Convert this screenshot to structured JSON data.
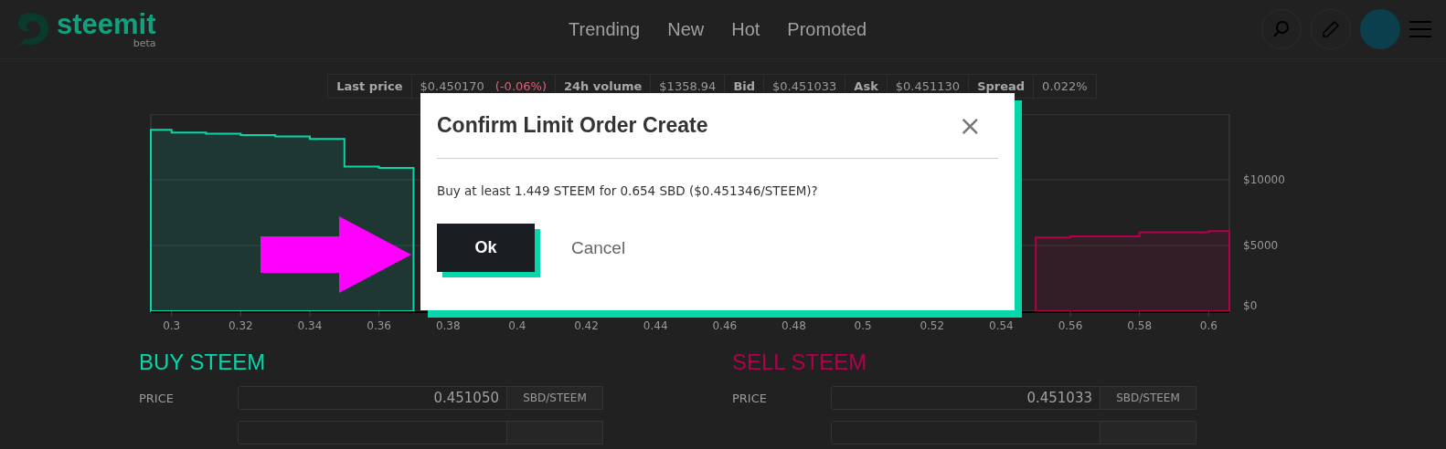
{
  "header": {
    "logo": {
      "name": "steemit",
      "badge": "beta"
    },
    "nav": [
      {
        "label": "Trending"
      },
      {
        "label": "New"
      },
      {
        "label": "Hot"
      },
      {
        "label": "Promoted"
      }
    ]
  },
  "ticker": [
    {
      "label": "Last price",
      "value": "$0.450170",
      "change": "(-0.06%)"
    },
    {
      "label": "24h volume",
      "value": "$1358.94"
    },
    {
      "label": "Bid",
      "value": "$0.451033"
    },
    {
      "label": "Ask",
      "value": "$0.451130"
    },
    {
      "label": "Spread",
      "value": "0.022%"
    }
  ],
  "chart": {
    "chart_data": {
      "type": "area",
      "x": [
        0.294,
        0.3,
        0.31,
        0.32,
        0.33,
        0.34,
        0.35,
        0.36,
        0.37,
        0.38,
        0.39,
        0.4,
        0.41,
        0.42,
        0.43,
        0.44,
        0.45,
        0.46,
        0.47,
        0.48,
        0.49,
        0.5,
        0.51,
        0.52,
        0.53,
        0.54,
        0.55,
        0.56,
        0.57,
        0.58,
        0.59,
        0.6,
        0.606
      ],
      "series": [
        {
          "color": "#06d6a9",
          "values": [
            13800,
            13600,
            13500,
            13400,
            13300,
            13100,
            11000,
            10900,
            10900,
            null,
            null,
            null,
            null,
            null,
            null,
            null,
            null,
            null,
            null,
            null,
            null,
            null,
            null,
            null,
            null,
            null,
            null,
            null,
            null,
            null,
            null,
            null,
            null
          ]
        },
        {
          "color": "#b2004d",
          "values": [
            null,
            null,
            null,
            null,
            null,
            null,
            null,
            null,
            null,
            null,
            null,
            null,
            null,
            null,
            null,
            null,
            null,
            null,
            null,
            null,
            null,
            null,
            null,
            null,
            null,
            null,
            5600,
            5700,
            5700,
            6000,
            6000,
            6100,
            6100
          ]
        }
      ],
      "xlim": [
        0.294,
        0.606
      ],
      "ylim": [
        0,
        15000
      ],
      "xticks": [
        0.3,
        0.32,
        0.34,
        0.36,
        0.38,
        0.4,
        0.42,
        0.44,
        0.46,
        0.48,
        0.5,
        0.52,
        0.54,
        0.56,
        0.58,
        0.6
      ],
      "yticks": [
        {
          "value": 0,
          "label": "$0"
        },
        {
          "value": 5000,
          "label": "$5000"
        },
        {
          "value": 10000,
          "label": "$10000"
        }
      ]
    }
  },
  "order_forms": [
    {
      "kind": "buy",
      "title": "BUY STEEM",
      "rows": [
        {
          "label": "PRICE",
          "value": "0.451050",
          "unit": "SBD/STEEM"
        }
      ]
    },
    {
      "kind": "sell",
      "title": "SELL STEEM",
      "rows": [
        {
          "label": "PRICE",
          "value": "0.451033",
          "unit": "SBD/STEEM"
        }
      ]
    }
  ],
  "dialog": {
    "title": "Confirm Limit Order Create",
    "close": "×",
    "message": "Buy at least 1.449 STEEM for 0.654 SBD ($0.451346/STEEM)?",
    "buttons": [
      {
        "label": "Ok",
        "kind": "primary"
      },
      {
        "label": "Cancel",
        "kind": "secondary"
      }
    ]
  }
}
